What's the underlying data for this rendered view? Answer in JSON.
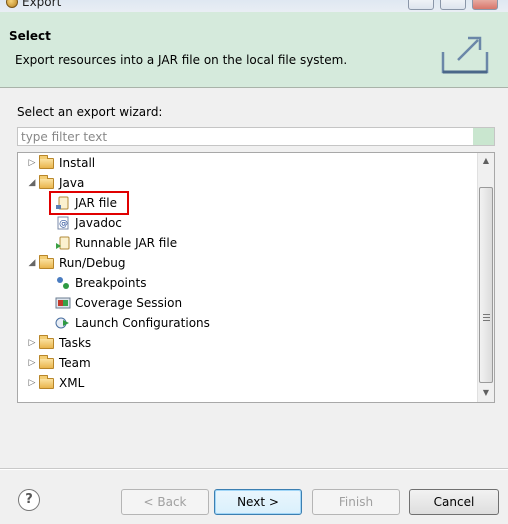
{
  "window": {
    "title": "Export"
  },
  "banner": {
    "heading": "Select",
    "description": "Export resources into a JAR file on the local file system.",
    "icon": "export-jar-wizard-icon"
  },
  "wizard": {
    "select_label": "Select an export wizard:",
    "filter_placeholder": "type filter text",
    "filter_value": ""
  },
  "tree": {
    "items": [
      {
        "label": "Install",
        "icon": "folder-icon",
        "expanded": false,
        "level": 0
      },
      {
        "label": "Java",
        "icon": "folder-open-icon",
        "expanded": true,
        "level": 0
      },
      {
        "label": "JAR file",
        "icon": "jar-file-icon",
        "level": 1,
        "selected": true
      },
      {
        "label": "Javadoc",
        "icon": "javadoc-icon",
        "level": 1
      },
      {
        "label": "Runnable JAR file",
        "icon": "runnable-jar-icon",
        "level": 1
      },
      {
        "label": "Run/Debug",
        "icon": "folder-open-icon",
        "expanded": true,
        "level": 0
      },
      {
        "label": "Breakpoints",
        "icon": "breakpoints-icon",
        "level": 1
      },
      {
        "label": "Coverage Session",
        "icon": "coverage-session-icon",
        "level": 1
      },
      {
        "label": "Launch Configurations",
        "icon": "launch-configurations-icon",
        "level": 1
      },
      {
        "label": "Tasks",
        "icon": "folder-icon",
        "expanded": false,
        "level": 0
      },
      {
        "label": "Team",
        "icon": "folder-icon",
        "expanded": false,
        "level": 0
      },
      {
        "label": "XML",
        "icon": "folder-icon",
        "expanded": false,
        "level": 0
      }
    ]
  },
  "buttons": {
    "help": "?",
    "back": "< Back",
    "next": "Next >",
    "finish": "Finish",
    "cancel": "Cancel"
  },
  "colors": {
    "banner_bg": "#d5eadc",
    "highlight": "#e00000"
  }
}
